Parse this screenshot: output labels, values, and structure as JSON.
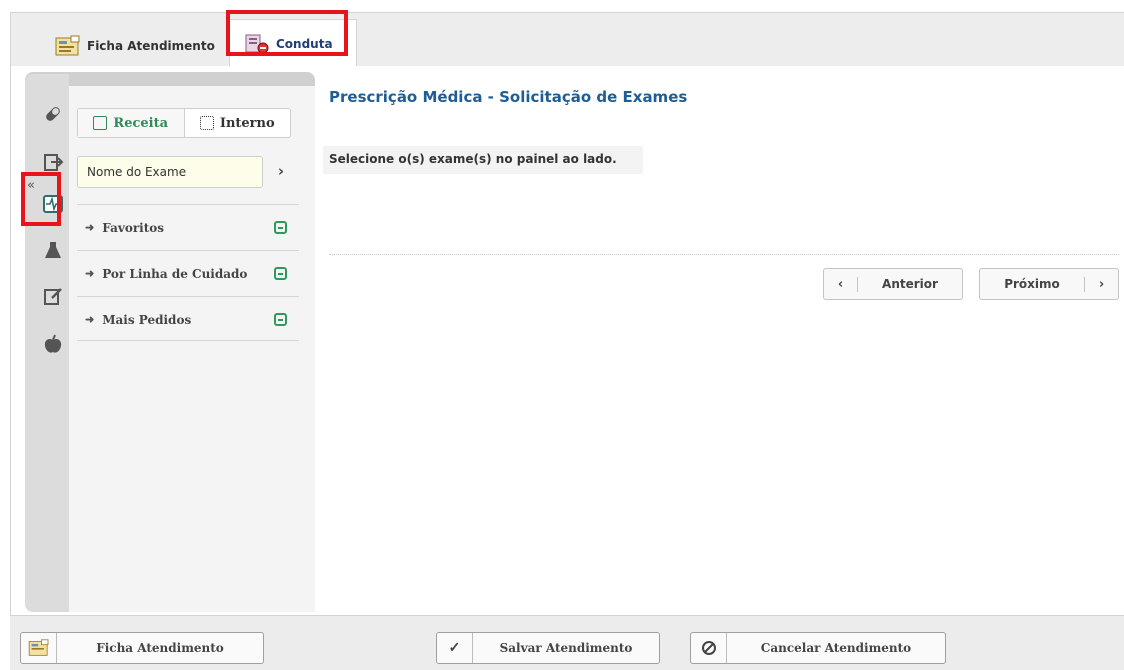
{
  "tabs": [
    {
      "label": "Ficha Atendimento",
      "icon": "ficha-icon"
    },
    {
      "label": "Conduta",
      "icon": "conduta-icon"
    }
  ],
  "sidebar": {
    "collapse_glyph": "«",
    "icons": [
      "pill-icon",
      "export-icon",
      "exam-heartbeat-icon",
      "flask-icon",
      "edit-icon",
      "apple-icon"
    ]
  },
  "panel": {
    "subtabs": [
      {
        "label": "Receita",
        "icon": "document-icon"
      },
      {
        "label": "Interno",
        "icon": "hospital-icon"
      }
    ],
    "search": {
      "value": "Nome do Exame"
    },
    "accordion": [
      {
        "label": "Favoritos"
      },
      {
        "label": "Por Linha de Cuidado"
      },
      {
        "label": "Mais Pedidos"
      }
    ]
  },
  "content": {
    "title": "Prescrição Médica - Solicitação de Exames",
    "message": "Selecione o(s) exame(s) no painel ao lado.",
    "prev_label": "Anterior",
    "next_label": "Próximo"
  },
  "footer": {
    "ficha_label": "Ficha Atendimento",
    "salvar_label": "Salvar Atendimento",
    "cancelar_label": "Cancelar Atendimento"
  },
  "colors": {
    "accent_green": "#2e9a5a",
    "title_blue": "#1f5e94",
    "highlight_red": "#e8141c"
  }
}
